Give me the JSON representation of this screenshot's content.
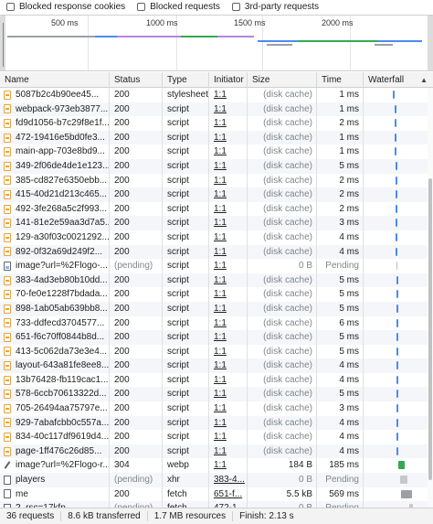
{
  "filters": [
    {
      "label": "Blocked response cookies",
      "checked": false
    },
    {
      "label": "Blocked requests",
      "checked": false
    },
    {
      "label": "3rd-party requests",
      "checked": false
    }
  ],
  "timeline": {
    "ticks": [
      "500 ms",
      "1000 ms",
      "1500 ms",
      "2000 ms"
    ]
  },
  "columns": {
    "name": "Name",
    "status": "Status",
    "type": "Type",
    "initiator": "Initiator",
    "size": "Size",
    "time": "Time",
    "waterfall": "Waterfall"
  },
  "rows": [
    {
      "icon": "script",
      "name": "5087b2c4b90ee45...",
      "status": "200",
      "type": "stylesheet",
      "initiator": "1:1",
      "size": "(disk cache)",
      "time": "1 ms"
    },
    {
      "icon": "script",
      "name": "webpack-973eb3877...",
      "status": "200",
      "type": "script",
      "initiator": "1:1",
      "size": "(disk cache)",
      "time": "1 ms"
    },
    {
      "icon": "script",
      "name": "fd9d1056-b7c29f8e1f...",
      "status": "200",
      "type": "script",
      "initiator": "1:1",
      "size": "(disk cache)",
      "time": "2 ms"
    },
    {
      "icon": "script",
      "name": "472-19416e5bd0fe3...",
      "status": "200",
      "type": "script",
      "initiator": "1:1",
      "size": "(disk cache)",
      "time": "1 ms"
    },
    {
      "icon": "script",
      "name": "main-app-703e8bd9...",
      "status": "200",
      "type": "script",
      "initiator": "1:1",
      "size": "(disk cache)",
      "time": "1 ms"
    },
    {
      "icon": "script",
      "name": "349-2f06de4de1e123...",
      "status": "200",
      "type": "script",
      "initiator": "1:1",
      "size": "(disk cache)",
      "time": "5 ms"
    },
    {
      "icon": "script",
      "name": "385-cd827e6350ebb...",
      "status": "200",
      "type": "script",
      "initiator": "1:1",
      "size": "(disk cache)",
      "time": "2 ms"
    },
    {
      "icon": "script",
      "name": "415-40d21d213c465...",
      "status": "200",
      "type": "script",
      "initiator": "1:1",
      "size": "(disk cache)",
      "time": "2 ms"
    },
    {
      "icon": "script",
      "name": "492-3fe268a5c2f993...",
      "status": "200",
      "type": "script",
      "initiator": "1:1",
      "size": "(disk cache)",
      "time": "2 ms"
    },
    {
      "icon": "script",
      "name": "141-81e2e59aa3d7a5...",
      "status": "200",
      "type": "script",
      "initiator": "1:1",
      "size": "(disk cache)",
      "time": "3 ms"
    },
    {
      "icon": "script",
      "name": "129-a30f03c0021292...",
      "status": "200",
      "type": "script",
      "initiator": "1:1",
      "size": "(disk cache)",
      "time": "4 ms"
    },
    {
      "icon": "script",
      "name": "892-0f32a69d249f2...",
      "status": "200",
      "type": "script",
      "initiator": "1:1",
      "size": "(disk cache)",
      "time": "4 ms"
    },
    {
      "icon": "img",
      "name": "image?url=%2Flogo-...",
      "status": "(pending)",
      "type": "script",
      "initiator": "1:1",
      "size": "0 B",
      "time": "Pending"
    },
    {
      "icon": "script",
      "name": "383-4ad3eb80b10dd...",
      "status": "200",
      "type": "script",
      "initiator": "1:1",
      "size": "(disk cache)",
      "time": "5 ms"
    },
    {
      "icon": "script",
      "name": "70-fe0e1228f7bdada...",
      "status": "200",
      "type": "script",
      "initiator": "1:1",
      "size": "(disk cache)",
      "time": "5 ms"
    },
    {
      "icon": "script",
      "name": "898-1ab05ab639bb8...",
      "status": "200",
      "type": "script",
      "initiator": "1:1",
      "size": "(disk cache)",
      "time": "5 ms"
    },
    {
      "icon": "script",
      "name": "733-ddfecd3704577...",
      "status": "200",
      "type": "script",
      "initiator": "1:1",
      "size": "(disk cache)",
      "time": "6 ms"
    },
    {
      "icon": "script",
      "name": "651-f6c70ff0844b8d...",
      "status": "200",
      "type": "script",
      "initiator": "1:1",
      "size": "(disk cache)",
      "time": "5 ms"
    },
    {
      "icon": "script",
      "name": "413-5c062da73e3e4...",
      "status": "200",
      "type": "script",
      "initiator": "1:1",
      "size": "(disk cache)",
      "time": "5 ms"
    },
    {
      "icon": "script",
      "name": "layout-643a81fe8ee8...",
      "status": "200",
      "type": "script",
      "initiator": "1:1",
      "size": "(disk cache)",
      "time": "4 ms"
    },
    {
      "icon": "script",
      "name": "13b76428-fb119cac1...",
      "status": "200",
      "type": "script",
      "initiator": "1:1",
      "size": "(disk cache)",
      "time": "4 ms"
    },
    {
      "icon": "script",
      "name": "578-6ccb70613322d...",
      "status": "200",
      "type": "script",
      "initiator": "1:1",
      "size": "(disk cache)",
      "time": "5 ms"
    },
    {
      "icon": "script",
      "name": "705-26494aa75797e...",
      "status": "200",
      "type": "script",
      "initiator": "1:1",
      "size": "(disk cache)",
      "time": "3 ms"
    },
    {
      "icon": "script",
      "name": "929-7abafcbb0c557a...",
      "status": "200",
      "type": "script",
      "initiator": "1:1",
      "size": "(disk cache)",
      "time": "4 ms"
    },
    {
      "icon": "script",
      "name": "834-40c117df9619d4...",
      "status": "200",
      "type": "script",
      "initiator": "1:1",
      "size": "(disk cache)",
      "time": "4 ms"
    },
    {
      "icon": "script",
      "name": "page-1ff476c26d85...",
      "status": "200",
      "type": "script",
      "initiator": "1:1",
      "size": "(disk cache)",
      "time": "4 ms"
    },
    {
      "icon": "pen",
      "name": "image?url=%2Flogo-r...",
      "status": "304",
      "type": "webp",
      "initiator": "1:1",
      "size": "184 B",
      "time": "185 ms"
    },
    {
      "icon": "xhr",
      "name": "players",
      "status": "(pending)",
      "type": "xhr",
      "initiator": "383-4...",
      "size": "0 B",
      "time": "Pending"
    },
    {
      "icon": "fetch",
      "name": "me",
      "status": "200",
      "type": "fetch",
      "initiator": "651-f...",
      "size": "5.5 kB",
      "time": "569 ms"
    },
    {
      "icon": "doc",
      "name": "?_rsc=17kfp",
      "status": "(pending)",
      "type": "fetch",
      "initiator": "472-1...",
      "size": "0 B",
      "time": "Pending"
    }
  ],
  "status_bar": {
    "requests": "36 requests",
    "transferred": "8.6 kB transferred",
    "resources": "1.7 MB resources",
    "finish": "Finish: 2.13 s"
  },
  "colors": {
    "script_orange": "#e8a33d",
    "waterfall_blue": "#4a8af4",
    "waterfall_green": "#34a853",
    "waterfall_gray": "#9aa0a6",
    "overview_purple": "#b388d8"
  }
}
